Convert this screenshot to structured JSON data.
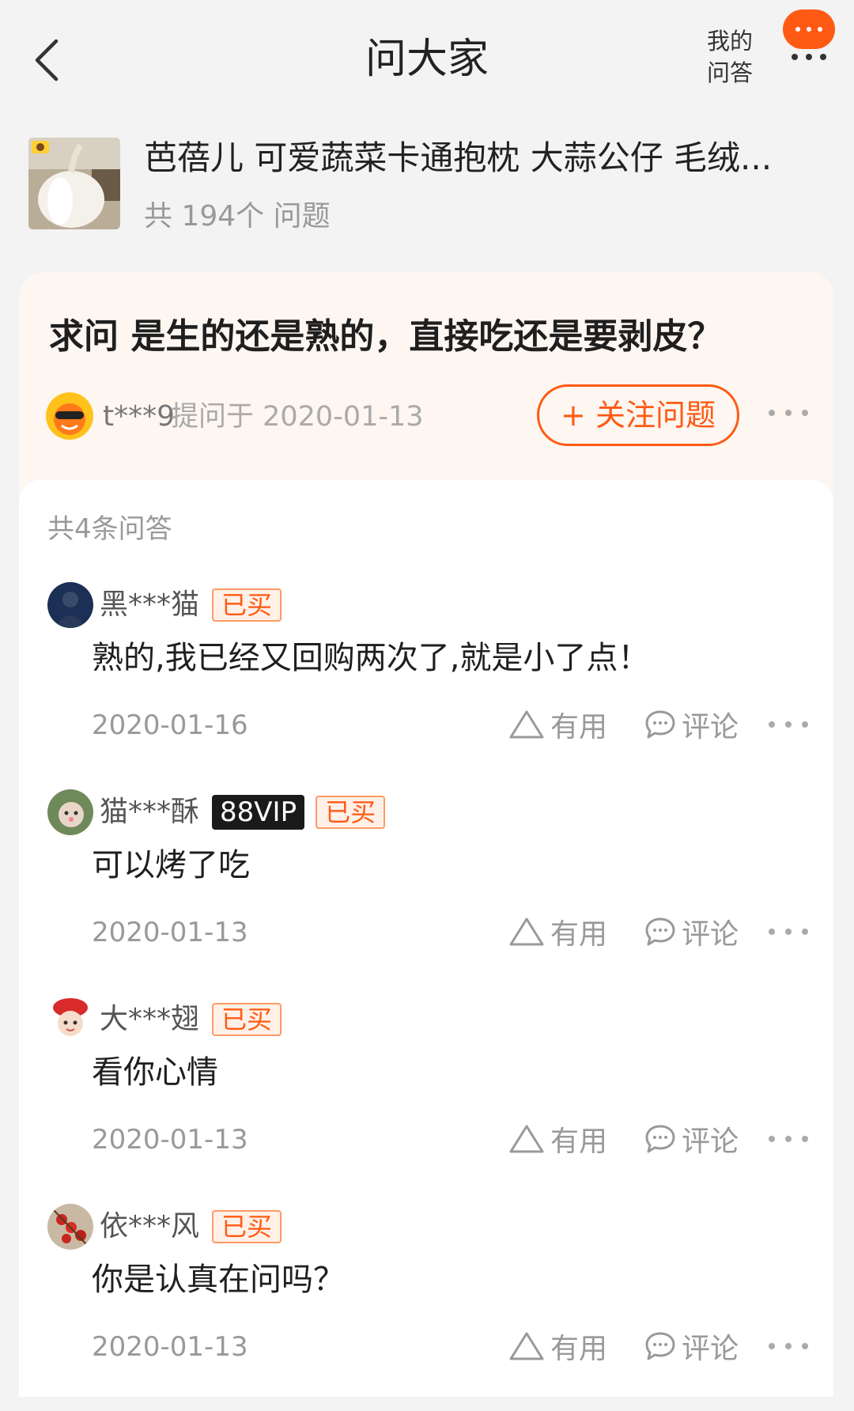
{
  "header": {
    "title": "问大家",
    "my_qa_line1": "我的",
    "my_qa_line2": "问答"
  },
  "product": {
    "title": "芭蓓儿 可爱蔬菜卡通抱枕 大蒜公仔 毛绒...",
    "count": "共 194个 问题"
  },
  "question": {
    "text": "求问 是生的还是熟的，直接吃还是要剥皮？",
    "asker": "t***9",
    "asked_at": "提问于 2020-01-13",
    "follow_label": "+ 关注问题"
  },
  "answers_count": "共4条问答",
  "answers": [
    {
      "name": "黑***猫",
      "vip": "",
      "bought": "已买",
      "text": "熟的,我已经又回购两次了,就是小了点！",
      "date": "2020-01-16",
      "useful": "有用",
      "comment": "评论"
    },
    {
      "name": "猫***酥",
      "vip": "88VIP",
      "bought": "已买",
      "text": "可以烤了吃",
      "date": "2020-01-13",
      "useful": "有用",
      "comment": "评论"
    },
    {
      "name": "大***翅",
      "vip": "",
      "bought": "已买",
      "text": "看你心情",
      "date": "2020-01-13",
      "useful": "有用",
      "comment": "评论"
    },
    {
      "name": "依***风",
      "vip": "",
      "bought": "已买",
      "text": "你是认真在问吗？",
      "date": "2020-01-13",
      "useful": "有用",
      "comment": "评论"
    }
  ],
  "colors": {
    "accent": "#ff5a14",
    "question_bg": "#fdf6f1",
    "page_bg": "#f3f3f3"
  },
  "icons": [
    "back-arrow-icon",
    "message-more-icon",
    "more-dots-icon",
    "triangle-useful-icon",
    "comment-bubble-icon"
  ]
}
